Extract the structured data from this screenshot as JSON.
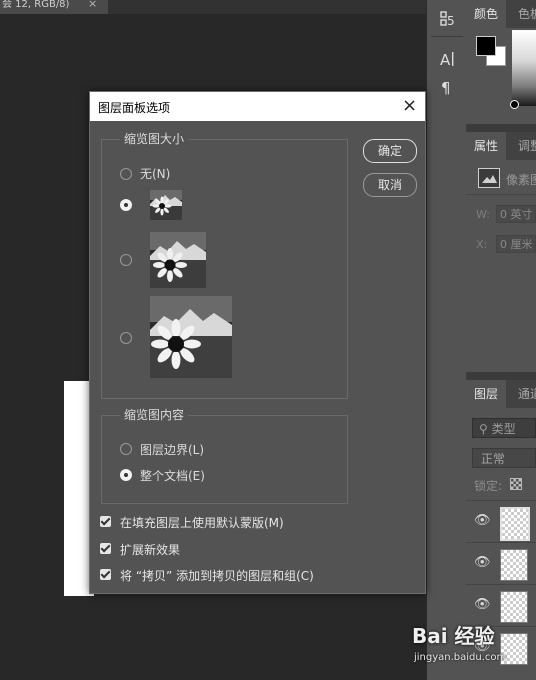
{
  "document": {
    "tab_title": "会 12, RGB/8)",
    "tab_close": "×"
  },
  "tool_strip": {
    "tools": [
      "paragraph-style-icon",
      "character-icon",
      "paragraph-icon"
    ]
  },
  "panels": {
    "color": {
      "tab_active": "颜色",
      "tab_other": "色板"
    },
    "properties": {
      "tab_active": "属性",
      "tab_other": "调整",
      "label": "像素图层",
      "w_label": "W:",
      "w_value": "0 英寸",
      "x_label": "X:",
      "x_value": "0 厘米"
    },
    "layers": {
      "tab_active": "图层",
      "tab_other": "通道",
      "search_placeholder": "类型",
      "blend_mode": "正常",
      "lock_label": "锁定:"
    }
  },
  "dialog": {
    "title": "图层面板选项",
    "close": "×",
    "thumbnail_size": {
      "legend": "缩览图大小",
      "options": [
        {
          "label": "无(N)",
          "checked": false
        },
        {
          "label": "",
          "size": "small",
          "checked": true
        },
        {
          "label": "",
          "size": "medium",
          "checked": false
        },
        {
          "label": "",
          "size": "large",
          "checked": false
        }
      ]
    },
    "thumbnail_content": {
      "legend": "缩览图内容",
      "options": [
        {
          "label": "图层边界(L)",
          "checked": false
        },
        {
          "label": "整个文档(E)",
          "checked": true
        }
      ]
    },
    "checkboxes": [
      {
        "label": "在填充图层上使用默认蒙版(M)",
        "checked": true
      },
      {
        "label": "扩展新效果",
        "checked": true
      },
      {
        "label": "将 “拷贝” 添加到拷贝的图层和组(C)",
        "checked": true
      }
    ],
    "ok_label": "确定",
    "cancel_label": "取消"
  },
  "watermark": {
    "brand": "Bai 经验",
    "url": "jingyan.baidu.com"
  }
}
